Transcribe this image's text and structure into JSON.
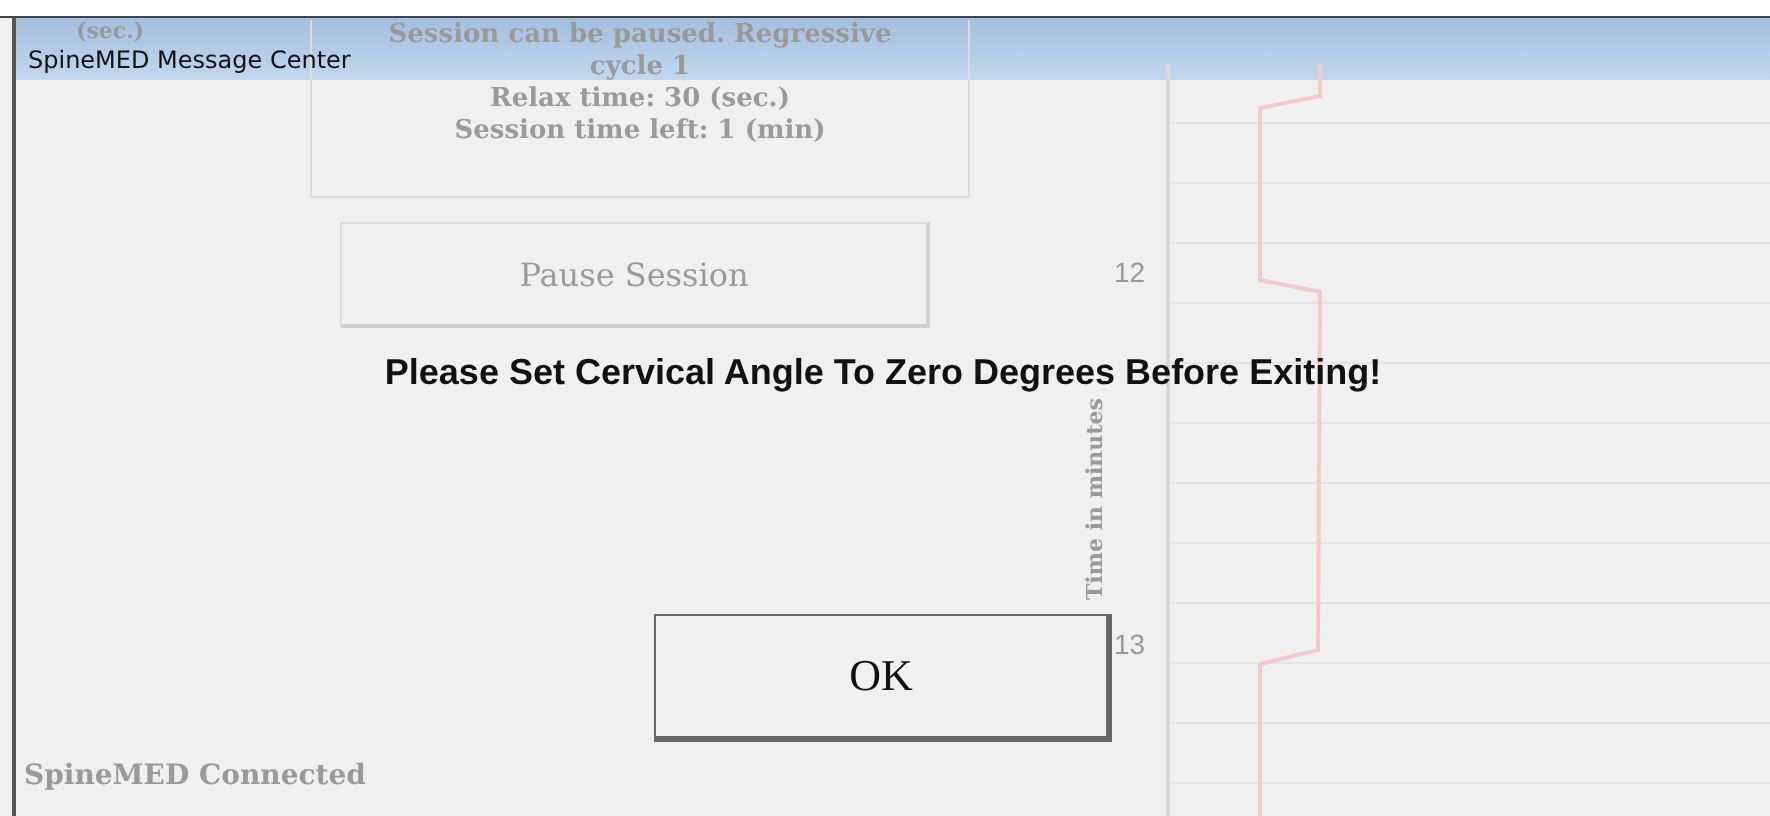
{
  "background": {
    "left_label": "(sec.)",
    "status_lines": [
      "Session can be paused. Regressive",
      "cycle 1",
      "Relax time: 30 (sec.)",
      "Session time left: 1 (min)"
    ],
    "pause_button": {
      "label": "Pause Session"
    },
    "chart": {
      "axis_title": "Time in minutes",
      "ticks": [
        "12",
        "13"
      ]
    },
    "footer": "SpineMED Connected"
  },
  "dialog": {
    "title": "SpineMED Message Center",
    "message": "Please Set Cervical Angle To Zero Degrees Before Exiting!",
    "buttons": [
      {
        "label": "OK"
      }
    ]
  }
}
